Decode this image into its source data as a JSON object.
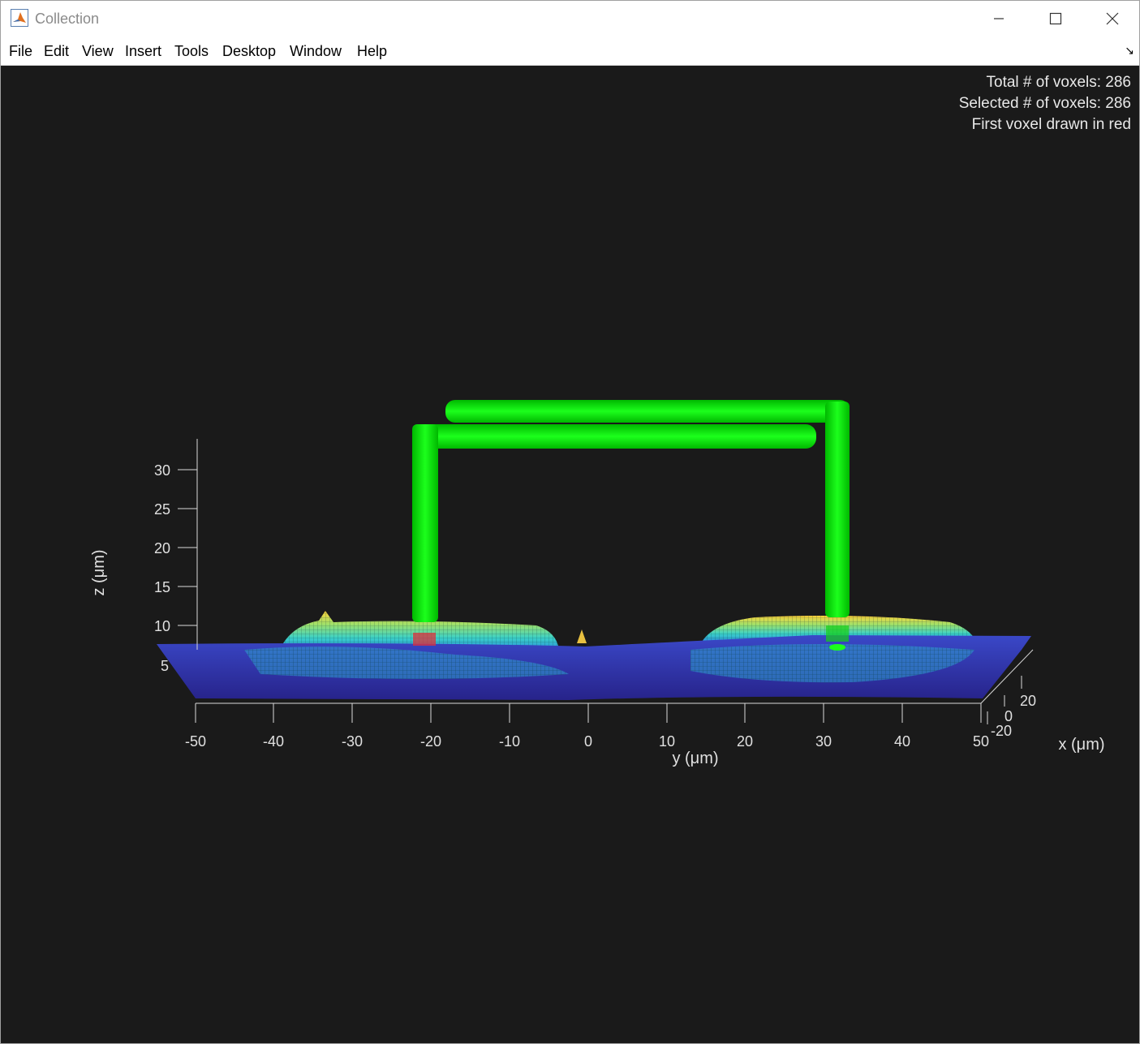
{
  "window": {
    "title": "Collection",
    "minimize_glyph": "—",
    "maximize_glyph": "☐",
    "close_glyph": "✕"
  },
  "menu": {
    "items": [
      "File",
      "Edit",
      "View",
      "Insert",
      "Tools",
      "Desktop",
      "Window",
      "Help"
    ],
    "dock_glyph": "↘"
  },
  "info": {
    "total": "Total # of voxels: 286",
    "selected": "Selected # of voxels: 286",
    "note": "First voxel drawn in red"
  },
  "colors": {
    "figure_bg": "#1a1a1a",
    "axis": "#d9d9d9",
    "voxel": "#00e600",
    "first_voxel": "#e0303a",
    "surface_low": "#2e2ea8",
    "surface_high": "#ffd23a"
  },
  "chart_data": {
    "type": "surface",
    "x_axis": {
      "label": "x (μm)",
      "ticks": [
        "20",
        "0",
        "-20"
      ]
    },
    "y_axis": {
      "label": "y (μm)",
      "ticks": [
        "-50",
        "-40",
        "-30",
        "-20",
        "-10",
        "0",
        "10",
        "20",
        "30",
        "40",
        "50"
      ]
    },
    "z_axis": {
      "label": "z (μm)",
      "ticks": [
        "5",
        "10",
        "15",
        "20",
        "25",
        "30"
      ]
    }
  }
}
